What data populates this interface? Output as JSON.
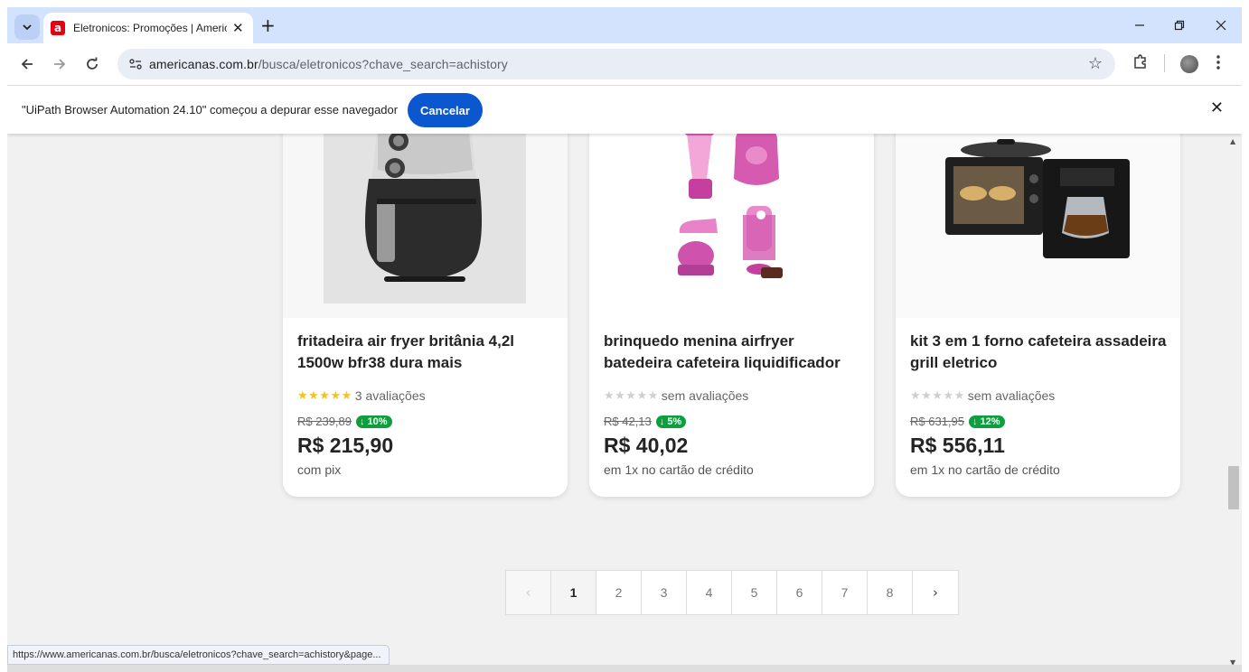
{
  "browser": {
    "tab_title": "Eletronicos: Promoções | Americanas",
    "favicon_letter": "a",
    "new_tab": "+",
    "url_host": "americanas.com.br",
    "url_path": "/busca/eletronicos?chave_search=achistory",
    "status_url": "https://www.americanas.com.br/busca/eletronicos?chave_search=achistory&page..."
  },
  "infobar": {
    "message": "\"UiPath Browser Automation 24.10\" começou a depurar esse navegador",
    "cancel_label": "Cancelar"
  },
  "products": [
    {
      "name": "fritadeira air fryer britânia 4,2l 1500w bfr38 dura mais",
      "stars_filled": 5,
      "stars_text": "★★★★★",
      "rating_text": "3 avaliações",
      "old_price": "R$ 239,89",
      "discount": "↓ 10%",
      "price": "R$ 215,90",
      "payment": "com pix"
    },
    {
      "name": "brinquedo menina airfryer batedeira cafeteira liquidificador",
      "stars_filled": 0,
      "stars_text": "★★★★★",
      "rating_text": "sem avaliações",
      "old_price": "R$ 42,13",
      "discount": "↓ 5%",
      "price": "R$ 40,02",
      "payment": "em 1x no cartão de crédito"
    },
    {
      "name": "kit 3 em 1 forno cafeteira assadeira grill eletrico",
      "stars_filled": 0,
      "stars_text": "★★★★★",
      "rating_text": "sem avaliações",
      "old_price": "R$ 631,95",
      "discount": "↓ 12%",
      "price": "R$ 556,11",
      "payment": "em 1x no cartão de crédito"
    }
  ],
  "pagination": {
    "prev": "‹",
    "next": "›",
    "current": "1",
    "pages": [
      "1",
      "2",
      "3",
      "4",
      "5",
      "6",
      "7",
      "8"
    ]
  },
  "colors": {
    "tabstrip": "#d3e3fd",
    "accent_button": "#0b57d0",
    "discount_badge": "#0d9e3e",
    "star_gold": "#f8c21c",
    "brand_red": "#e60014"
  }
}
